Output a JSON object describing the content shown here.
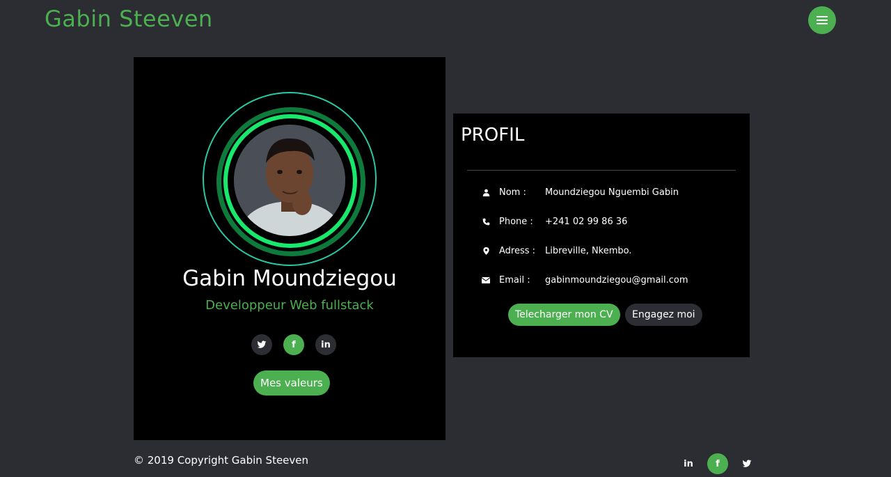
{
  "header": {
    "brand": "Gabin Steeven",
    "menu_icon": "hamburger-menu-icon"
  },
  "profile_card": {
    "name": "Gabin Moundziegou",
    "role": "Developpeur Web fullstack",
    "socials": [
      {
        "icon": "twitter-icon",
        "glyph": "🐦"
      },
      {
        "icon": "facebook-icon",
        "glyph": "f"
      },
      {
        "icon": "linkedin-icon",
        "glyph": "in"
      }
    ],
    "values_button": "Mes valeurs"
  },
  "profil": {
    "title": "PROFIL",
    "rows": [
      {
        "icon": "user-icon",
        "label": "Nom :",
        "value": "Moundziegou Nguembi Gabin"
      },
      {
        "icon": "phone-icon",
        "label": "Phone :",
        "value": "+241 02 99 86 36"
      },
      {
        "icon": "map-marker-icon",
        "label": "Adress :",
        "value": "Libreville, Nkembo."
      },
      {
        "icon": "envelope-icon",
        "label": "Email :",
        "value": "gabinmoundziegou@gmail.com"
      }
    ],
    "download_cv": "Telecharger mon CV",
    "hire_me": "Engagez moi"
  },
  "footer": {
    "copyright": "© 2019 Copyright Gabin Steeven",
    "socials": [
      {
        "icon": "linkedin-icon",
        "glyph": "in"
      },
      {
        "icon": "facebook-icon",
        "glyph": "f"
      },
      {
        "icon": "twitter-icon",
        "glyph": "🐦"
      }
    ]
  },
  "colors": {
    "accent": "#4caf50",
    "background": "#2b2d33",
    "card": "#000000",
    "ring_teal": "#26c9a4",
    "ring_bright": "#18e86b"
  }
}
